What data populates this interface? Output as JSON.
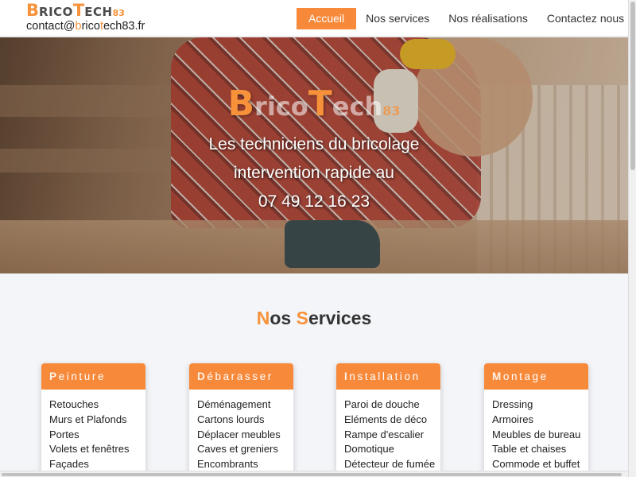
{
  "brand": {
    "logo_b": "B",
    "logo_rico": "RICO",
    "logo_t": "T",
    "logo_ech": "ECH",
    "logo_num": "83",
    "email_pre": "contact@",
    "email_b": "b",
    "email_rico": "rico",
    "email_t": "t",
    "email_post": "ech83.fr"
  },
  "nav": {
    "items": [
      "Accueil",
      "Nos services",
      "Nos réalisations",
      "Contactez nous"
    ],
    "active": "Accueil"
  },
  "hero": {
    "logo_b": "B",
    "logo_rico": "rico",
    "logo_t": "T",
    "logo_ech": "ech",
    "logo_num": "83",
    "line1": "Les techniciens du bricolage",
    "line2": "intervention rapide au",
    "phone": "07 49 12 16 23"
  },
  "services": {
    "title_n": "N",
    "title_os": "os ",
    "title_s": "S",
    "title_ervices": "ervices",
    "cards": [
      {
        "initial": "P",
        "rest": "einture",
        "items": [
          "Retouches",
          "Murs et Plafonds",
          "Portes",
          "Volets et fenêtres",
          "Façades"
        ]
      },
      {
        "initial": "D",
        "rest": "ébarasser",
        "items": [
          "Déménagement",
          "Cartons lourds",
          "Déplacer meubles",
          "Caves et greniers",
          "Encombrants"
        ]
      },
      {
        "initial": "I",
        "rest": "nstallation",
        "items": [
          "Paroi de douche",
          "Eléments de déco",
          "Rampe d'escalier",
          "Domotique",
          "Détecteur de fumée"
        ]
      },
      {
        "initial": "M",
        "rest": "ontage",
        "items": [
          "Dressing",
          "Armoires",
          "Meubles de bureau",
          "Table et chaises",
          "Commode et buffet"
        ]
      }
    ]
  },
  "colors": {
    "accent": "#f7893b",
    "text": "#333333",
    "background": "#f4f5f8"
  }
}
